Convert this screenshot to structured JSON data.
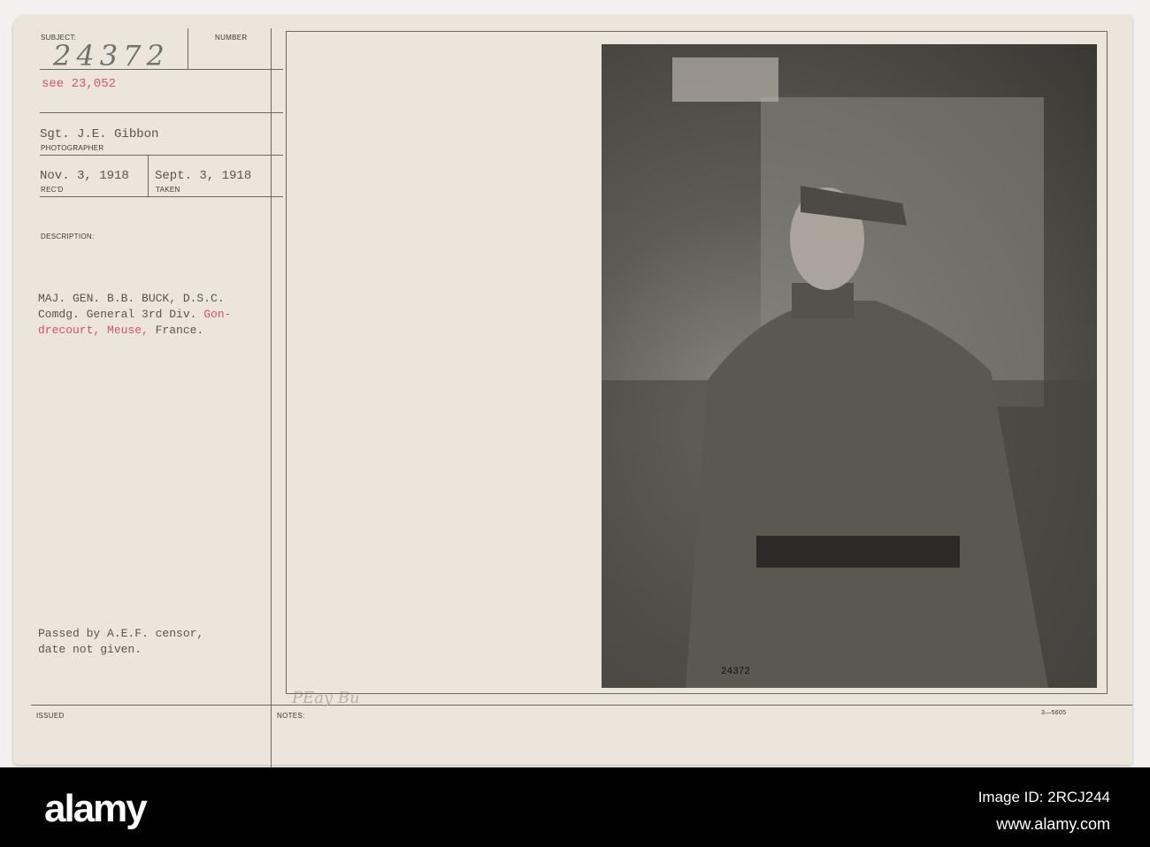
{
  "card": {
    "subject_label": "SUBJECT:",
    "number_label": "NUMBER",
    "subject_number": "24372",
    "see_ref": "see 23,052",
    "photographer": "Sgt. J.E. Gibbon",
    "photographer_label": "PHOTOGRAPHER",
    "received": "Nov. 3, 1918",
    "received_label": "REC'D",
    "taken": "Sept. 3, 1918",
    "taken_label": "TAKEN",
    "description_label": "DESCRIPTION:",
    "description_line1": "MAJ. GEN. B.B. BUCK, D.S.C.",
    "description_line2_a": "Comdg. General 3rd Div. ",
    "description_line2_b": "Gon-",
    "description_line3_a": "drecourt, Meuse,",
    "description_line3_b": " France.",
    "censor_line1": "Passed by A.E.F. censor,",
    "censor_line2": "date not given.",
    "issued_label": "ISSUED",
    "notes_label": "NOTES:",
    "notes_handwritten": "PEay Bu",
    "form_number": "3—5605",
    "photo_number": "24372"
  },
  "footer": {
    "logo": "alamy",
    "image_id": "Image ID: 2RCJ244",
    "url": "www.alamy.com"
  },
  "colors": {
    "red_ink": "#d8536a",
    "card": "#ebe5db"
  }
}
